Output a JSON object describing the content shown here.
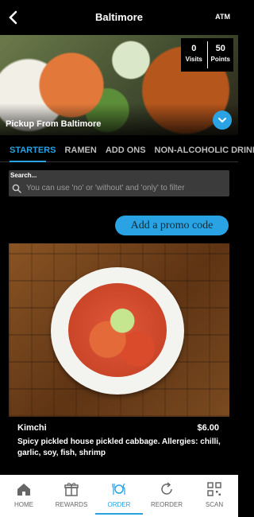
{
  "header": {
    "title": "Baltimore",
    "right_label": "ATM"
  },
  "hero": {
    "pickup_text": "Pickup From Baltimore",
    "stats": [
      {
        "value": "0",
        "label": "Visits"
      },
      {
        "value": "50",
        "label": "Points"
      }
    ]
  },
  "tabs": [
    {
      "label": "STARTERS",
      "active": true
    },
    {
      "label": "RAMEN"
    },
    {
      "label": "ADD ONS"
    },
    {
      "label": "NON-ALCOHOLIC DRINKS"
    }
  ],
  "search": {
    "label": "Search...",
    "placeholder": "You can use 'no' or 'without' and 'only' to filter"
  },
  "promo": {
    "label": "Add a promo code"
  },
  "product": {
    "name": "Kimchi",
    "price": "$6.00",
    "description": "Spicy pickled house pickled cabbage. Allergies: chilli, garlic, soy, fish, shrimp"
  },
  "nav": [
    {
      "label": "HOME",
      "icon": "home-icon"
    },
    {
      "label": "REWARDS",
      "icon": "gift-icon"
    },
    {
      "label": "ORDER",
      "icon": "dining-icon",
      "active": true
    },
    {
      "label": "REORDER",
      "icon": "reorder-icon"
    },
    {
      "label": "SCAN",
      "icon": "qr-code-icon"
    }
  ],
  "colors": {
    "accent": "#29a3e3",
    "background": "#000000",
    "search_bg": "#3b3b3b"
  }
}
